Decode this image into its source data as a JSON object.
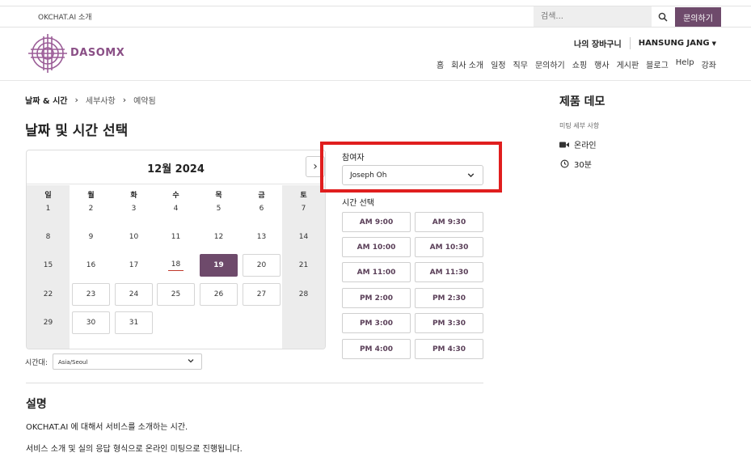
{
  "topbar": {
    "about_link": "OKCHAT.AI 소개",
    "search_placeholder": "검색...",
    "contact_button": "문의하기"
  },
  "header": {
    "logo_text": "DASOMX",
    "cart_label": "나의 장바구니",
    "user_name": "HANSUNG JANG",
    "nav": [
      "홈",
      "회사 소개",
      "일정",
      "직무",
      "문의하기",
      "쇼핑",
      "행사",
      "게시판",
      "블로그",
      "Help",
      "강좌"
    ]
  },
  "breadcrumb": {
    "step1": "날짜 & 시간",
    "step2": "세부사항",
    "step3": "예약됨"
  },
  "page_title": "날짜 및 시간 선택",
  "calendar": {
    "month_label": "12월 2024",
    "weekdays": [
      "일",
      "월",
      "화",
      "수",
      "목",
      "금",
      "토"
    ],
    "weeks": [
      [
        "1",
        "2",
        "3",
        "4",
        "5",
        "6",
        "7"
      ],
      [
        "8",
        "9",
        "10",
        "11",
        "12",
        "13",
        "14"
      ],
      [
        "15",
        "16",
        "17",
        "18",
        "19",
        "20",
        "21"
      ],
      [
        "22",
        "23",
        "24",
        "25",
        "26",
        "27",
        "28"
      ],
      [
        "29",
        "30",
        "31"
      ]
    ],
    "selected_day": "19",
    "today": "18"
  },
  "timezone": {
    "label": "시간대:",
    "value": "Asia/Seoul"
  },
  "attendee": {
    "label": "참여자",
    "value": "Joseph Oh"
  },
  "time_select": {
    "label": "시간 선택",
    "slots": [
      "AM 9:00",
      "AM 9:30",
      "AM 10:00",
      "AM 10:30",
      "AM 11:00",
      "AM 11:30",
      "PM 2:00",
      "PM 2:30",
      "PM 3:00",
      "PM 3:30",
      "PM 4:00",
      "PM 4:30"
    ]
  },
  "description": {
    "title": "설명",
    "line1": "OKCHAT.AI 에 대해서 서비스를 소개하는 시간.",
    "line2": "서비스 소개 및 실의 응답 형식으로 온라인 미팅으로 진행됩니다."
  },
  "sidebar": {
    "title": "제품 데모",
    "meta_label": "미팅 세부 사항",
    "location": "온라인",
    "duration": "30분"
  },
  "colors": {
    "brand": "#6e4a6b",
    "highlight": "#e01e1e",
    "weekend_bg": "#ececec"
  }
}
